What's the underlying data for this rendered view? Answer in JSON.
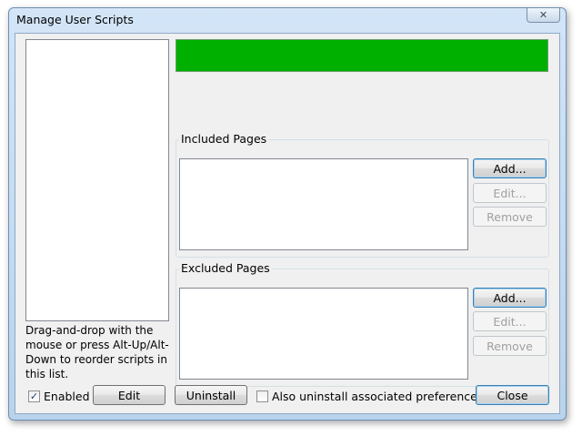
{
  "window": {
    "title": "Manage User Scripts",
    "close_glyph": "✕"
  },
  "scripts": {
    "items": [],
    "hint": "Drag-and-drop with the mouse or press Alt-Up/Alt-Down to reorder scripts in this list."
  },
  "status_color": "#00b000",
  "included": {
    "label": "Included Pages",
    "items": [],
    "add_label": "Add...",
    "edit_label": "Edit...",
    "remove_label": "Remove"
  },
  "excluded": {
    "label": "Excluded Pages",
    "items": [],
    "add_label": "Add...",
    "edit_label": "Edit...",
    "remove_label": "Remove"
  },
  "footer": {
    "enabled_label": "Enabled",
    "enabled_checked": true,
    "edit_label": "Edit",
    "uninstall_label": "Uninstall",
    "uninstall_prefs_label": "Also uninstall associated preferences",
    "uninstall_prefs_checked": false,
    "close_label": "Close",
    "check_glyph": "✓"
  }
}
